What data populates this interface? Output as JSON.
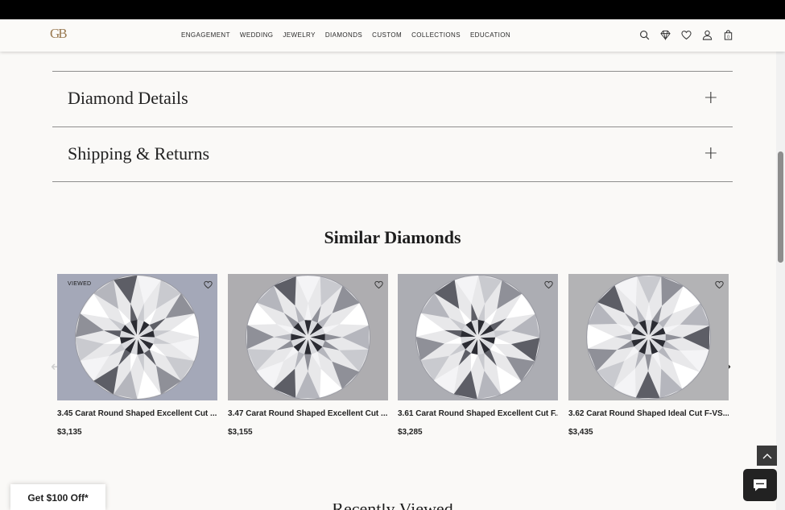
{
  "header": {
    "logo": "GB",
    "nav": [
      "ENGAGEMENT",
      "WEDDING",
      "JEWELRY",
      "DIAMONDS",
      "CUSTOM",
      "COLLECTIONS",
      "EDUCATION"
    ],
    "icons": [
      "search-icon",
      "diamond-icon",
      "heart-icon",
      "user-icon",
      "bag-icon"
    ],
    "cart_count": "0"
  },
  "accordion": [
    {
      "title": "Diamond Details",
      "icon": "+"
    },
    {
      "title": "Shipping & Returns",
      "icon": "+"
    }
  ],
  "similar": {
    "title": "Similar Diamonds",
    "cards": [
      {
        "badge": "VIEWED",
        "name": "3.45 Carat Round Shaped Excellent Cut ...",
        "price": "$3,135",
        "bg": "#a4a8b8"
      },
      {
        "badge": "",
        "name": "3.47 Carat Round Shaped Excellent Cut ...",
        "price": "$3,155",
        "bg": "#aeadb0"
      },
      {
        "badge": "",
        "name": "3.61 Carat Round Shaped Excellent Cut F...",
        "price": "$3,285",
        "bg": "#acadb3"
      },
      {
        "badge": "",
        "name": "3.62 Carat Round Shaped Ideal Cut F-VS...",
        "price": "$3,435",
        "bg": "#b3b3b5"
      }
    ]
  },
  "promo": {
    "label": "Get $100 Off*"
  },
  "recently_viewed": {
    "title": "Recently Viewed"
  }
}
